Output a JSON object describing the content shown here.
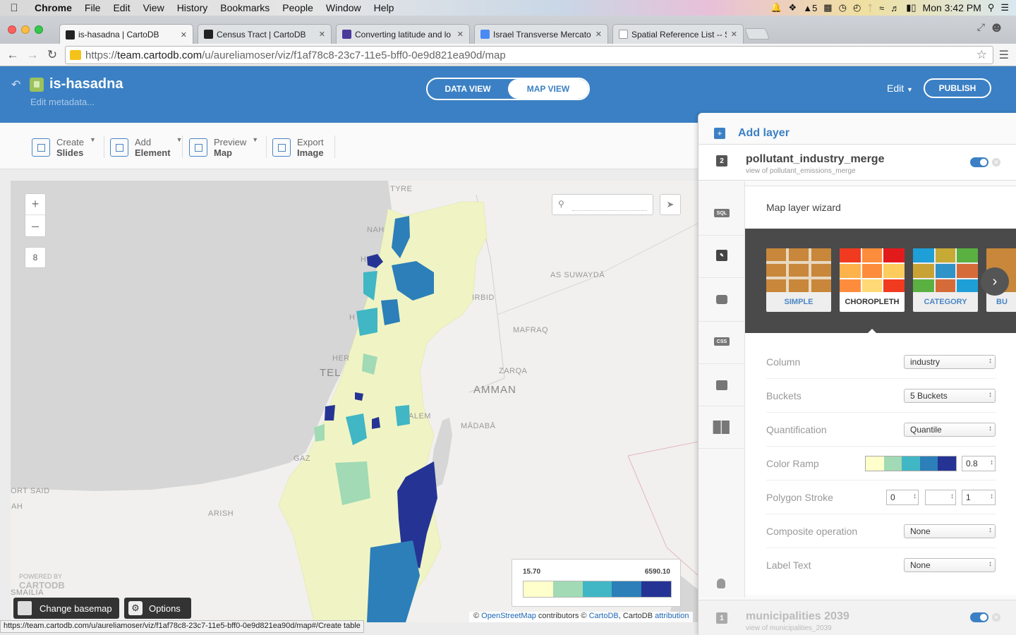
{
  "menubar": {
    "app": "Chrome",
    "items": [
      "File",
      "Edit",
      "View",
      "History",
      "Bookmarks",
      "People",
      "Window",
      "Help"
    ],
    "adobe_badge": "5",
    "clock": "Mon 3:42 PM"
  },
  "browser": {
    "tabs": [
      {
        "title": "is-hasadna | CartoDB",
        "favicon_color": "#222222"
      },
      {
        "title": "Census Tract | CartoDB",
        "favicon_color": "#222222"
      },
      {
        "title": "Converting latitude and lo",
        "favicon_color": "#4a3a9a"
      },
      {
        "title": "Israel Transverse Mercator",
        "favicon_color": "#4a8af4"
      },
      {
        "title": "Spatial Reference List -- Sp",
        "favicon_color": "#ffffff"
      }
    ],
    "url_scheme": "https://",
    "url_host": "team.cartodb.com",
    "url_path": "/u/aureliamoser/viz/f1af78c8-23c7-11e5-bff0-0e9d821ea90d/map",
    "status_url": "https://team.cartodb.com/u/aureliamoser/viz/f1af78c8-23c7-11e5-bff0-0e9d821ea90d/map#/Create table"
  },
  "header": {
    "title": "is-hasadna",
    "edit_metadata": "Edit metadata...",
    "data_view": "DATA VIEW",
    "map_view": "MAP VIEW",
    "edit": "Edit",
    "publish": "PUBLISH"
  },
  "tools": [
    {
      "line1": "Create",
      "line2": "Slides"
    },
    {
      "line1": "Add",
      "line2": "Element"
    },
    {
      "line1": "Preview",
      "line2": "Map"
    },
    {
      "line1": "Export",
      "line2": "Image"
    }
  ],
  "map": {
    "zoom_in": "+",
    "zoom_out": "–",
    "zoom_level": "8",
    "labels": {
      "tyre": "TYRE",
      "nah": "NAH",
      "haifa": "H",
      "hadera": "H",
      "herzliya": "HER",
      "tel": "TEL",
      "as_suwayda": "AS SUWAYDĀ",
      "irbid": "IRBID",
      "mafraq": "MAFRAQ",
      "zarqa": "ZARQA",
      "amman": "AMMAN",
      "alem": "ALEM",
      "madaba": "MĀDABĀ",
      "gaz": "GAZ",
      "port_said": "ORT SAID",
      "ah": "AH",
      "arish": "ARISH",
      "ismailia": "SMAILIA"
    },
    "legend": {
      "min": "15.70",
      "max": "6590.10",
      "colors": [
        "#ffffcc",
        "#a1dab4",
        "#41b6c4",
        "#2c7fb8",
        "#253494"
      ]
    },
    "attribution": {
      "prefix": "© ",
      "osm": "OpenStreetMap",
      "middle": " contributors © ",
      "cartodb": "CartoDB",
      "comma": ", CartoDB ",
      "attribution": "attribution"
    },
    "powered_by": "POWERED BY",
    "powered_brand": "CARTODB",
    "change_basemap": "Change basemap",
    "options": "Options"
  },
  "panel": {
    "add_layer": "Add layer",
    "layer": {
      "number": "2",
      "name": "pollutant_industry_merge",
      "source": "view of pollutant_emissions_merge"
    },
    "side_icons": [
      "sql-icon",
      "wizard-icon",
      "infowindow-icon",
      "css-icon",
      "legend-icon",
      "filters-icon"
    ],
    "side_icon_text": {
      "sql": "SQL",
      "css": "CSS"
    },
    "wizard": {
      "title": "Map layer wizard",
      "types": [
        "SIMPLE",
        "CHOROPLETH",
        "CATEGORY",
        "BU"
      ],
      "selected": "CHOROPLETH",
      "rows": {
        "column": {
          "label": "Column",
          "value": "industry"
        },
        "buckets": {
          "label": "Buckets",
          "value": "5 Buckets"
        },
        "quantification": {
          "label": "Quantification",
          "value": "Quantile"
        },
        "color_ramp": {
          "label": "Color Ramp",
          "opacity": "0.8",
          "colors": [
            "#ffffcc",
            "#a1dab4",
            "#41b6c4",
            "#2c7fb8",
            "#253494"
          ]
        },
        "polygon_stroke": {
          "label": "Polygon Stroke",
          "width": "0",
          "opacity": "1"
        },
        "composite": {
          "label": "Composite operation",
          "value": "None"
        },
        "label_text": {
          "label": "Label Text",
          "value": "None"
        }
      }
    },
    "other_layer": {
      "number": "1",
      "name": "municipalities 2039",
      "source": "view of municipalities_2039"
    }
  }
}
